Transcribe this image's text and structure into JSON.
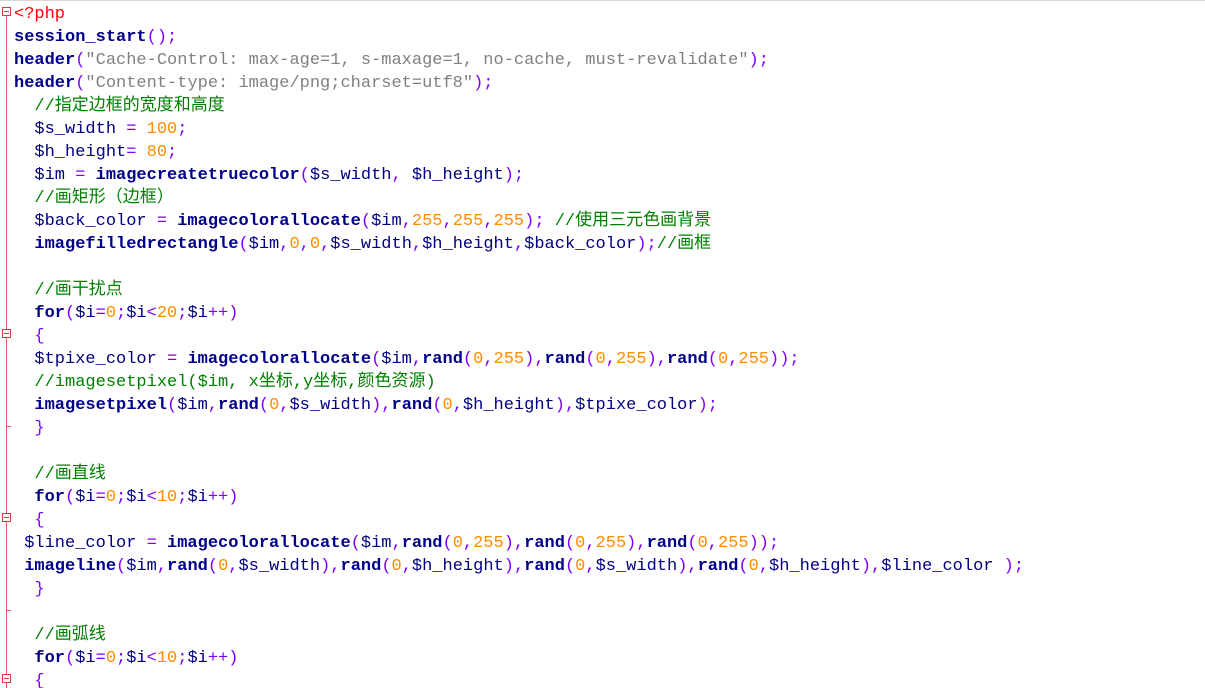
{
  "editor": {
    "lines": [
      [
        {
          "t": "<?php",
          "c": "tag"
        }
      ],
      [
        {
          "t": "session_start",
          "c": "kw"
        },
        {
          "t": "();",
          "c": "op"
        }
      ],
      [
        {
          "t": "header",
          "c": "kw"
        },
        {
          "t": "(",
          "c": "op"
        },
        {
          "t": "\"Cache-Control: max-age=1, s-maxage=1, no-cache, must-revalidate\"",
          "c": "str"
        },
        {
          "t": ");",
          "c": "op"
        }
      ],
      [
        {
          "t": "header",
          "c": "kw"
        },
        {
          "t": "(",
          "c": "op"
        },
        {
          "t": "\"Content-type: image/png;charset=utf8\"",
          "c": "str"
        },
        {
          "t": ");",
          "c": "op"
        }
      ],
      [
        {
          "t": "  ",
          "c": "text"
        },
        {
          "t": "//指定边框的宽度和高度",
          "c": "comment"
        }
      ],
      [
        {
          "t": "  ",
          "c": "text"
        },
        {
          "t": "$s_width",
          "c": "var"
        },
        {
          "t": " = ",
          "c": "op"
        },
        {
          "t": "100",
          "c": "num"
        },
        {
          "t": ";",
          "c": "op"
        }
      ],
      [
        {
          "t": "  ",
          "c": "text"
        },
        {
          "t": "$h_height",
          "c": "var"
        },
        {
          "t": "= ",
          "c": "op"
        },
        {
          "t": "80",
          "c": "num"
        },
        {
          "t": ";",
          "c": "op"
        }
      ],
      [
        {
          "t": "  ",
          "c": "text"
        },
        {
          "t": "$im",
          "c": "var"
        },
        {
          "t": " = ",
          "c": "op"
        },
        {
          "t": "imagecreatetruecolor",
          "c": "kw"
        },
        {
          "t": "(",
          "c": "op"
        },
        {
          "t": "$s_width",
          "c": "var"
        },
        {
          "t": ", ",
          "c": "op"
        },
        {
          "t": "$h_height",
          "c": "var"
        },
        {
          "t": ");",
          "c": "op"
        }
      ],
      [
        {
          "t": "  ",
          "c": "text"
        },
        {
          "t": "//画矩形（边框）",
          "c": "comment"
        }
      ],
      [
        {
          "t": "  ",
          "c": "text"
        },
        {
          "t": "$back_color",
          "c": "var"
        },
        {
          "t": " = ",
          "c": "op"
        },
        {
          "t": "imagecolorallocate",
          "c": "kw"
        },
        {
          "t": "(",
          "c": "op"
        },
        {
          "t": "$im",
          "c": "var"
        },
        {
          "t": ",",
          "c": "op"
        },
        {
          "t": "255",
          "c": "num"
        },
        {
          "t": ",",
          "c": "op"
        },
        {
          "t": "255",
          "c": "num"
        },
        {
          "t": ",",
          "c": "op"
        },
        {
          "t": "255",
          "c": "num"
        },
        {
          "t": "); ",
          "c": "op"
        },
        {
          "t": "//使用三元色画背景",
          "c": "comment"
        }
      ],
      [
        {
          "t": "  ",
          "c": "text"
        },
        {
          "t": "imagefilledrectangle",
          "c": "kw"
        },
        {
          "t": "(",
          "c": "op"
        },
        {
          "t": "$im",
          "c": "var"
        },
        {
          "t": ",",
          "c": "op"
        },
        {
          "t": "0",
          "c": "num"
        },
        {
          "t": ",",
          "c": "op"
        },
        {
          "t": "0",
          "c": "num"
        },
        {
          "t": ",",
          "c": "op"
        },
        {
          "t": "$s_width",
          "c": "var"
        },
        {
          "t": ",",
          "c": "op"
        },
        {
          "t": "$h_height",
          "c": "var"
        },
        {
          "t": ",",
          "c": "op"
        },
        {
          "t": "$back_color",
          "c": "var"
        },
        {
          "t": ");",
          "c": "op"
        },
        {
          "t": "//画框",
          "c": "comment"
        }
      ],
      [],
      [
        {
          "t": "  ",
          "c": "text"
        },
        {
          "t": "//画干扰点",
          "c": "comment"
        }
      ],
      [
        {
          "t": "  ",
          "c": "text"
        },
        {
          "t": "for",
          "c": "kw"
        },
        {
          "t": "(",
          "c": "op"
        },
        {
          "t": "$i",
          "c": "var"
        },
        {
          "t": "=",
          "c": "op"
        },
        {
          "t": "0",
          "c": "num"
        },
        {
          "t": ";",
          "c": "op"
        },
        {
          "t": "$i",
          "c": "var"
        },
        {
          "t": "<",
          "c": "op"
        },
        {
          "t": "20",
          "c": "num"
        },
        {
          "t": ";",
          "c": "op"
        },
        {
          "t": "$i",
          "c": "var"
        },
        {
          "t": "++)",
          "c": "op"
        }
      ],
      [
        {
          "t": "  ",
          "c": "text"
        },
        {
          "t": "{",
          "c": "op"
        }
      ],
      [
        {
          "t": "  ",
          "c": "text"
        },
        {
          "t": "$tpixe_color",
          "c": "var"
        },
        {
          "t": " = ",
          "c": "op"
        },
        {
          "t": "imagecolorallocate",
          "c": "kw"
        },
        {
          "t": "(",
          "c": "op"
        },
        {
          "t": "$im",
          "c": "var"
        },
        {
          "t": ",",
          "c": "op"
        },
        {
          "t": "rand",
          "c": "kw"
        },
        {
          "t": "(",
          "c": "op"
        },
        {
          "t": "0",
          "c": "num"
        },
        {
          "t": ",",
          "c": "op"
        },
        {
          "t": "255",
          "c": "num"
        },
        {
          "t": "),",
          "c": "op"
        },
        {
          "t": "rand",
          "c": "kw"
        },
        {
          "t": "(",
          "c": "op"
        },
        {
          "t": "0",
          "c": "num"
        },
        {
          "t": ",",
          "c": "op"
        },
        {
          "t": "255",
          "c": "num"
        },
        {
          "t": "),",
          "c": "op"
        },
        {
          "t": "rand",
          "c": "kw"
        },
        {
          "t": "(",
          "c": "op"
        },
        {
          "t": "0",
          "c": "num"
        },
        {
          "t": ",",
          "c": "op"
        },
        {
          "t": "255",
          "c": "num"
        },
        {
          "t": "));",
          "c": "op"
        }
      ],
      [
        {
          "t": "  ",
          "c": "text"
        },
        {
          "t": "//imagesetpixel($im, x坐标,y坐标,颜色资源)",
          "c": "comment"
        }
      ],
      [
        {
          "t": "  ",
          "c": "text"
        },
        {
          "t": "imagesetpixel",
          "c": "kw"
        },
        {
          "t": "(",
          "c": "op"
        },
        {
          "t": "$im",
          "c": "var"
        },
        {
          "t": ",",
          "c": "op"
        },
        {
          "t": "rand",
          "c": "kw"
        },
        {
          "t": "(",
          "c": "op"
        },
        {
          "t": "0",
          "c": "num"
        },
        {
          "t": ",",
          "c": "op"
        },
        {
          "t": "$s_width",
          "c": "var"
        },
        {
          "t": "),",
          "c": "op"
        },
        {
          "t": "rand",
          "c": "kw"
        },
        {
          "t": "(",
          "c": "op"
        },
        {
          "t": "0",
          "c": "num"
        },
        {
          "t": ",",
          "c": "op"
        },
        {
          "t": "$h_height",
          "c": "var"
        },
        {
          "t": "),",
          "c": "op"
        },
        {
          "t": "$tpixe_color",
          "c": "var"
        },
        {
          "t": ");",
          "c": "op"
        }
      ],
      [
        {
          "t": "  ",
          "c": "text"
        },
        {
          "t": "}",
          "c": "op"
        }
      ],
      [],
      [
        {
          "t": "  ",
          "c": "text"
        },
        {
          "t": "//画直线",
          "c": "comment"
        }
      ],
      [
        {
          "t": "  ",
          "c": "text"
        },
        {
          "t": "for",
          "c": "kw"
        },
        {
          "t": "(",
          "c": "op"
        },
        {
          "t": "$i",
          "c": "var"
        },
        {
          "t": "=",
          "c": "op"
        },
        {
          "t": "0",
          "c": "num"
        },
        {
          "t": ";",
          "c": "op"
        },
        {
          "t": "$i",
          "c": "var"
        },
        {
          "t": "<",
          "c": "op"
        },
        {
          "t": "10",
          "c": "num"
        },
        {
          "t": ";",
          "c": "op"
        },
        {
          "t": "$i",
          "c": "var"
        },
        {
          "t": "++)",
          "c": "op"
        }
      ],
      [
        {
          "t": "  ",
          "c": "text"
        },
        {
          "t": "{",
          "c": "op"
        }
      ],
      [
        {
          "t": " ",
          "c": "text"
        },
        {
          "t": "$line_color",
          "c": "var"
        },
        {
          "t": " = ",
          "c": "op"
        },
        {
          "t": "imagecolorallocate",
          "c": "kw"
        },
        {
          "t": "(",
          "c": "op"
        },
        {
          "t": "$im",
          "c": "var"
        },
        {
          "t": ",",
          "c": "op"
        },
        {
          "t": "rand",
          "c": "kw"
        },
        {
          "t": "(",
          "c": "op"
        },
        {
          "t": "0",
          "c": "num"
        },
        {
          "t": ",",
          "c": "op"
        },
        {
          "t": "255",
          "c": "num"
        },
        {
          "t": "),",
          "c": "op"
        },
        {
          "t": "rand",
          "c": "kw"
        },
        {
          "t": "(",
          "c": "op"
        },
        {
          "t": "0",
          "c": "num"
        },
        {
          "t": ",",
          "c": "op"
        },
        {
          "t": "255",
          "c": "num"
        },
        {
          "t": "),",
          "c": "op"
        },
        {
          "t": "rand",
          "c": "kw"
        },
        {
          "t": "(",
          "c": "op"
        },
        {
          "t": "0",
          "c": "num"
        },
        {
          "t": ",",
          "c": "op"
        },
        {
          "t": "255",
          "c": "num"
        },
        {
          "t": "));",
          "c": "op"
        }
      ],
      [
        {
          "t": " ",
          "c": "text"
        },
        {
          "t": "imageline",
          "c": "kw"
        },
        {
          "t": "(",
          "c": "op"
        },
        {
          "t": "$im",
          "c": "var"
        },
        {
          "t": ",",
          "c": "op"
        },
        {
          "t": "rand",
          "c": "kw"
        },
        {
          "t": "(",
          "c": "op"
        },
        {
          "t": "0",
          "c": "num"
        },
        {
          "t": ",",
          "c": "op"
        },
        {
          "t": "$s_width",
          "c": "var"
        },
        {
          "t": "),",
          "c": "op"
        },
        {
          "t": "rand",
          "c": "kw"
        },
        {
          "t": "(",
          "c": "op"
        },
        {
          "t": "0",
          "c": "num"
        },
        {
          "t": ",",
          "c": "op"
        },
        {
          "t": "$h_height",
          "c": "var"
        },
        {
          "t": "),",
          "c": "op"
        },
        {
          "t": "rand",
          "c": "kw"
        },
        {
          "t": "(",
          "c": "op"
        },
        {
          "t": "0",
          "c": "num"
        },
        {
          "t": ",",
          "c": "op"
        },
        {
          "t": "$s_width",
          "c": "var"
        },
        {
          "t": "),",
          "c": "op"
        },
        {
          "t": "rand",
          "c": "kw"
        },
        {
          "t": "(",
          "c": "op"
        },
        {
          "t": "0",
          "c": "num"
        },
        {
          "t": ",",
          "c": "op"
        },
        {
          "t": "$h_height",
          "c": "var"
        },
        {
          "t": "),",
          "c": "op"
        },
        {
          "t": "$line_color",
          "c": "var"
        },
        {
          "t": " );",
          "c": "op"
        }
      ],
      [
        {
          "t": "  ",
          "c": "text"
        },
        {
          "t": "}",
          "c": "op"
        }
      ],
      [],
      [
        {
          "t": "  ",
          "c": "text"
        },
        {
          "t": "//画弧线",
          "c": "comment"
        }
      ],
      [
        {
          "t": "  ",
          "c": "text"
        },
        {
          "t": "for",
          "c": "kw"
        },
        {
          "t": "(",
          "c": "op"
        },
        {
          "t": "$i",
          "c": "var"
        },
        {
          "t": "=",
          "c": "op"
        },
        {
          "t": "0",
          "c": "num"
        },
        {
          "t": ";",
          "c": "op"
        },
        {
          "t": "$i",
          "c": "var"
        },
        {
          "t": "<",
          "c": "op"
        },
        {
          "t": "10",
          "c": "num"
        },
        {
          "t": ";",
          "c": "op"
        },
        {
          "t": "$i",
          "c": "var"
        },
        {
          "t": "++)",
          "c": "op"
        }
      ],
      [
        {
          "t": "  ",
          "c": "text"
        },
        {
          "t": "{",
          "c": "op"
        }
      ]
    ]
  },
  "colors": {
    "keyword": "#00008b",
    "string": "#808080",
    "number": "#ff8c00",
    "comment": "#008000",
    "variable": "#000080",
    "operator": "#8000ff",
    "tag": "#ff0000",
    "fold_marker": "#d04040",
    "background": "#ffffff"
  }
}
